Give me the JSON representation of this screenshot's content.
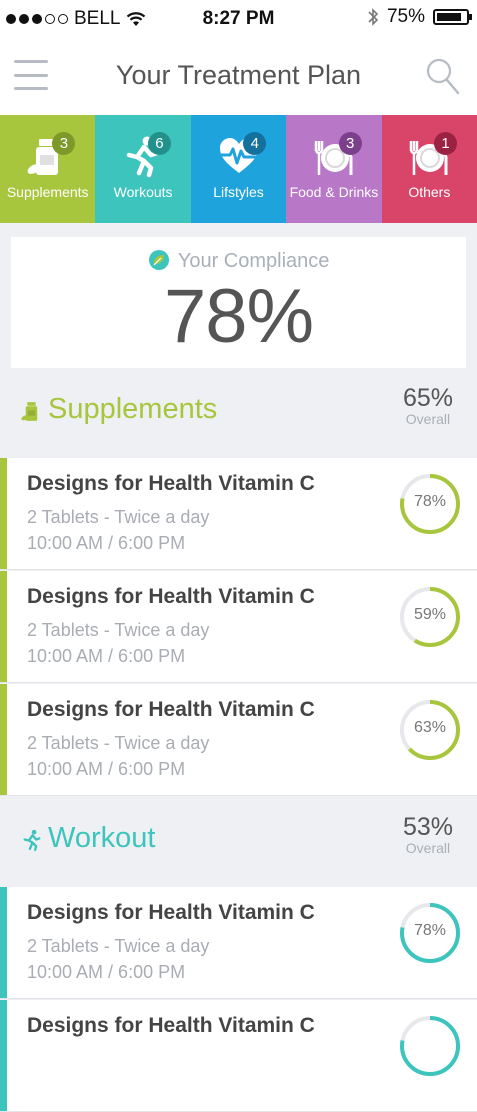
{
  "status_bar": {
    "carrier": "BELL",
    "time": "8:27 PM",
    "battery": "75%"
  },
  "nav": {
    "title": "Your Treatment Plan"
  },
  "tabs": [
    {
      "label": "Supplements",
      "count": "3",
      "color": "#a8c63d",
      "badge_color": "#7d9929",
      "icon": "pill-bottle-icon"
    },
    {
      "label": "Workouts",
      "count": "6",
      "color": "#3cc4bd",
      "badge_color": "#22918b",
      "icon": "running-person-icon"
    },
    {
      "label": "Lifstyles",
      "count": "4",
      "color": "#1fa3dc",
      "badge_color": "#14709c",
      "icon": "heart-pulse-icon"
    },
    {
      "label": "Food & Drinks",
      "count": "3",
      "color": "#b877c7",
      "badge_color": "#7b3f8b",
      "icon": "plate-cutlery-icon"
    },
    {
      "label": "Others",
      "count": "1",
      "color": "#d84569",
      "badge_color": "#9b2242",
      "icon": "plate-cutlery-icon"
    }
  ],
  "compliance": {
    "label": "Your Compliance",
    "value": "78%"
  },
  "sections": [
    {
      "title": "Supplements",
      "percent": "65%",
      "overall_label": "Overall",
      "color": "#a8c63d",
      "icon": "pill-bottle-icon",
      "items": [
        {
          "name": "Designs for Health Vitamin C",
          "dose": "2 Tablets - Twice a day",
          "time": "10:00 AM / 6:00 PM",
          "compliance": "78%",
          "progress": 0.78
        },
        {
          "name": "Designs for Health Vitamin C",
          "dose": "2 Tablets - Twice a day",
          "time": "10:00 AM / 6:00 PM",
          "compliance": "59%",
          "progress": 0.59
        },
        {
          "name": "Designs for Health Vitamin C",
          "dose": "2 Tablets - Twice a day",
          "time": "10:00 AM / 6:00 PM",
          "compliance": "63%",
          "progress": 0.63
        }
      ]
    },
    {
      "title": "Workout",
      "percent": "53%",
      "overall_label": "Overall",
      "color": "#3cc4bd",
      "icon": "running-person-icon",
      "items": [
        {
          "name": "Designs for Health Vitamin C",
          "dose": "2 Tablets - Twice a day",
          "time": "10:00 AM / 6:00 PM",
          "compliance": "78%",
          "progress": 0.78
        },
        {
          "name": "Designs for Health Vitamin C",
          "dose": "",
          "time": "",
          "compliance": "",
          "progress": 0.78
        }
      ]
    }
  ]
}
